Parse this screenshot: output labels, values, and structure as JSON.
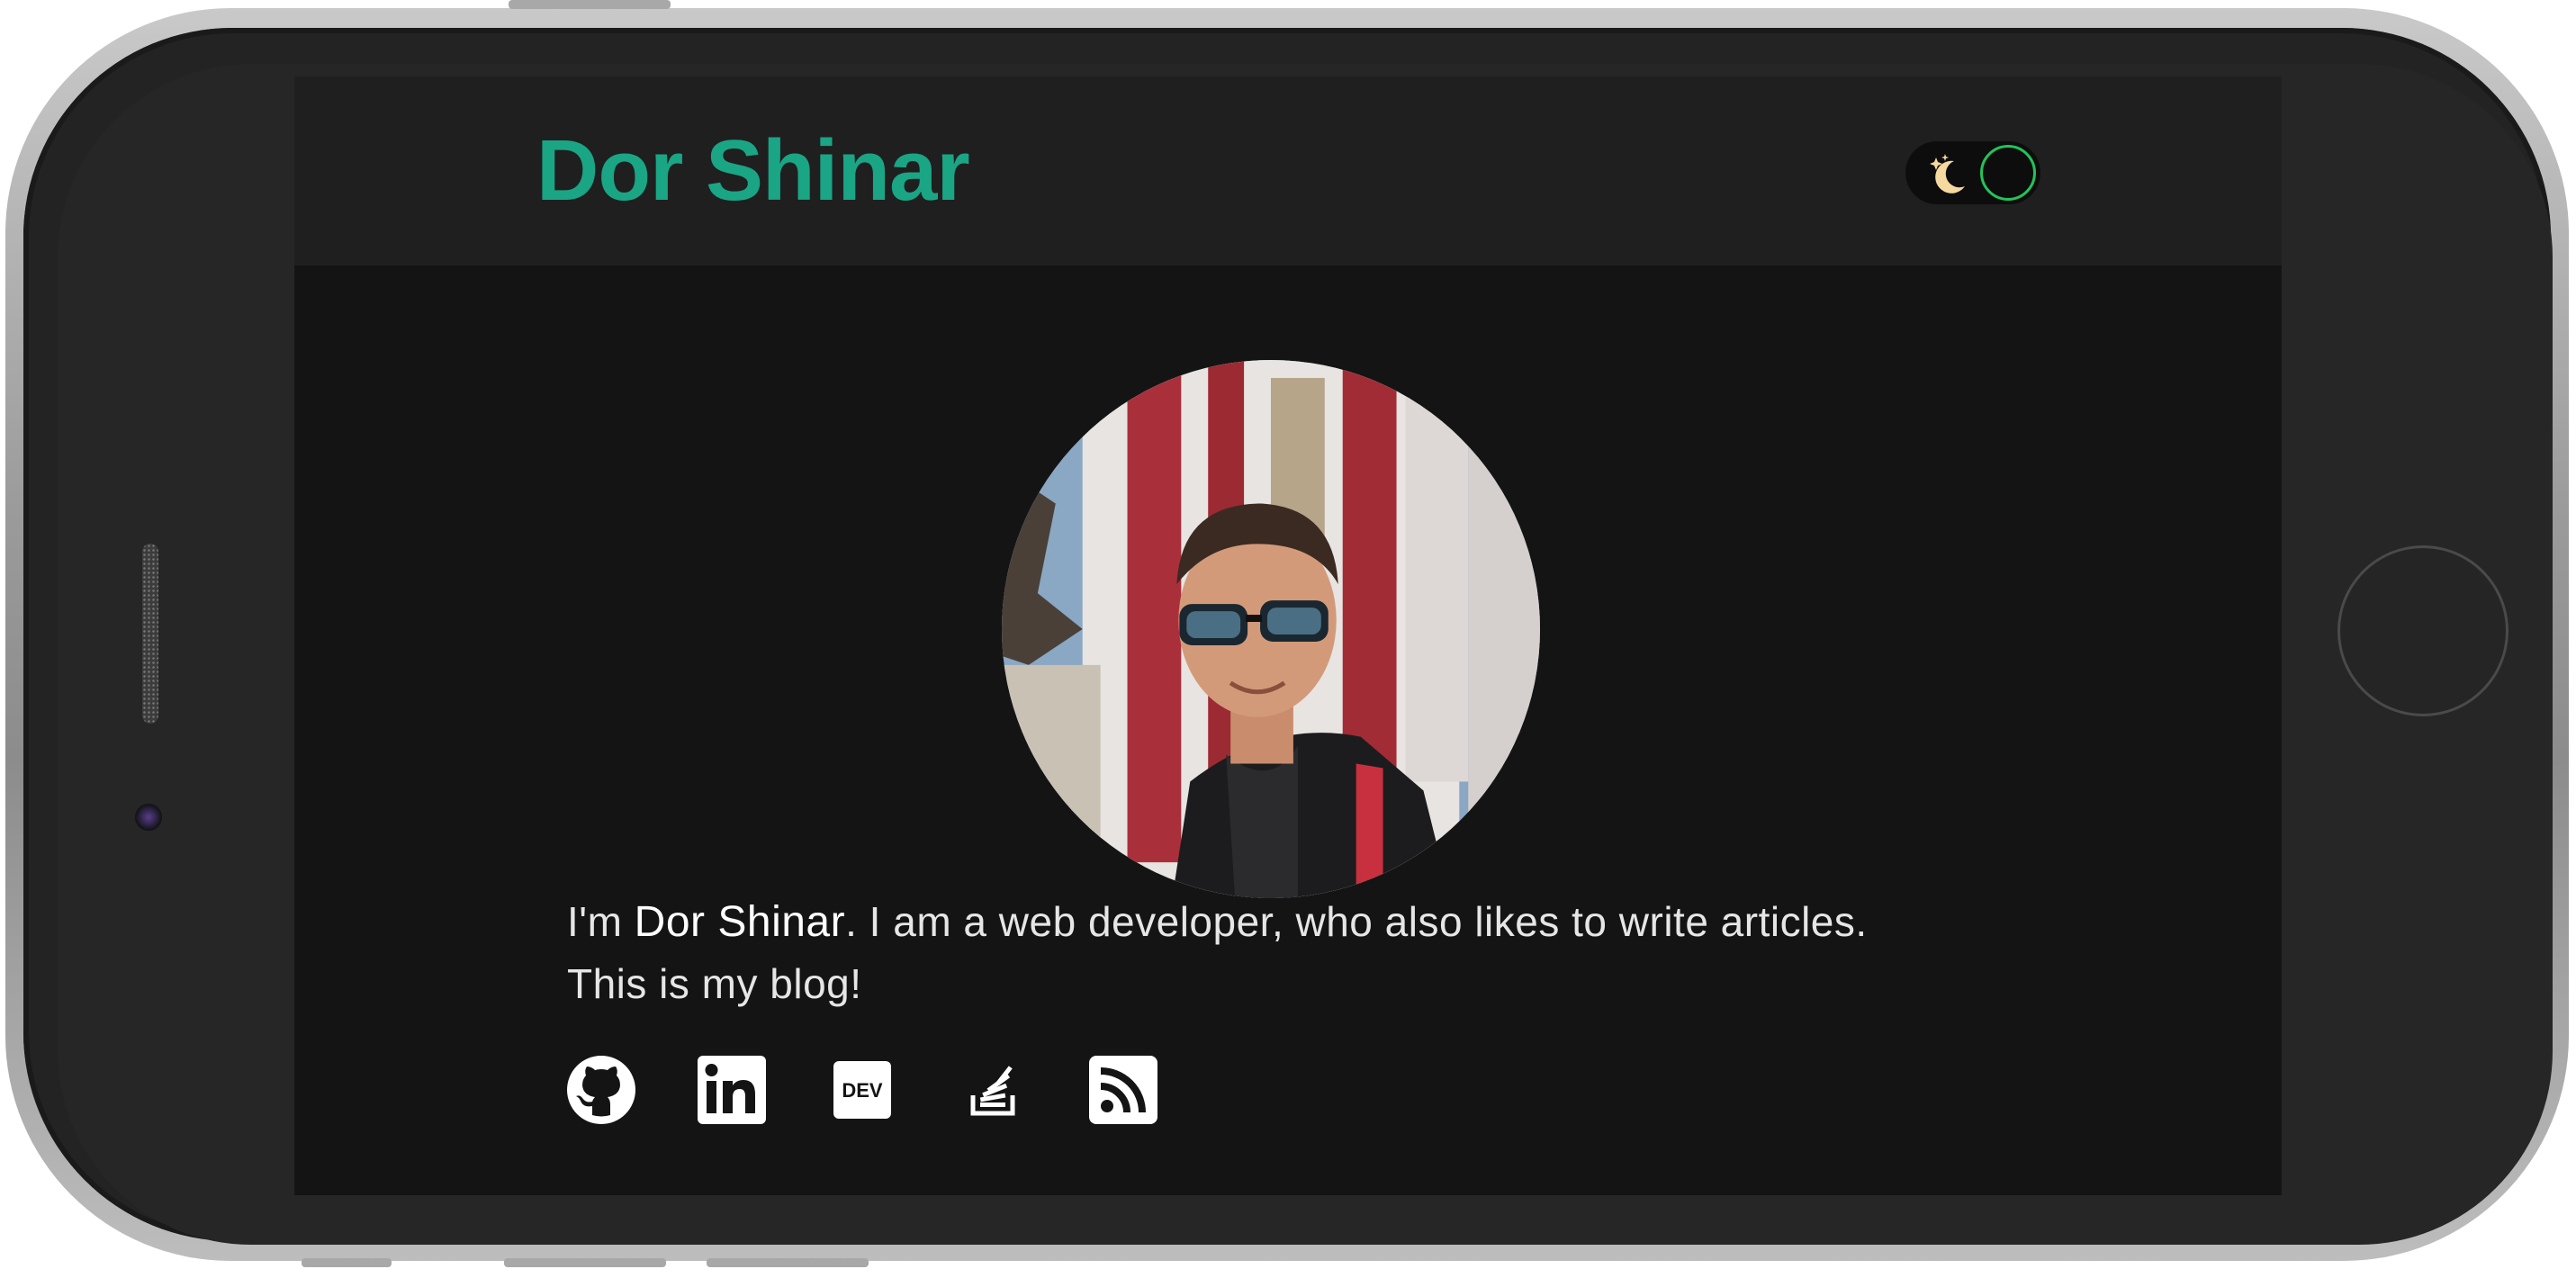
{
  "site": {
    "title": "Dor Shinar"
  },
  "theme_toggle": {
    "mode": "dark",
    "icon": "moon-stars-icon",
    "accent": "#22c35a"
  },
  "avatar": {
    "alt": "Dor Shinar"
  },
  "bio": {
    "prefix": "I'm ",
    "name": "Dor Shinar",
    "text": ". I am a web developer, who also likes to write articles. This is my blog!"
  },
  "social_links": [
    {
      "icon": "github-icon"
    },
    {
      "icon": "linkedin-icon"
    },
    {
      "icon": "dev-icon",
      "label": "DEV"
    },
    {
      "icon": "stackoverflow-icon"
    },
    {
      "icon": "rss-icon"
    }
  ],
  "colors": {
    "brand": "#1aa585",
    "background": "#141414",
    "header": "#1f1f1f",
    "text": "#e6e6e6"
  }
}
